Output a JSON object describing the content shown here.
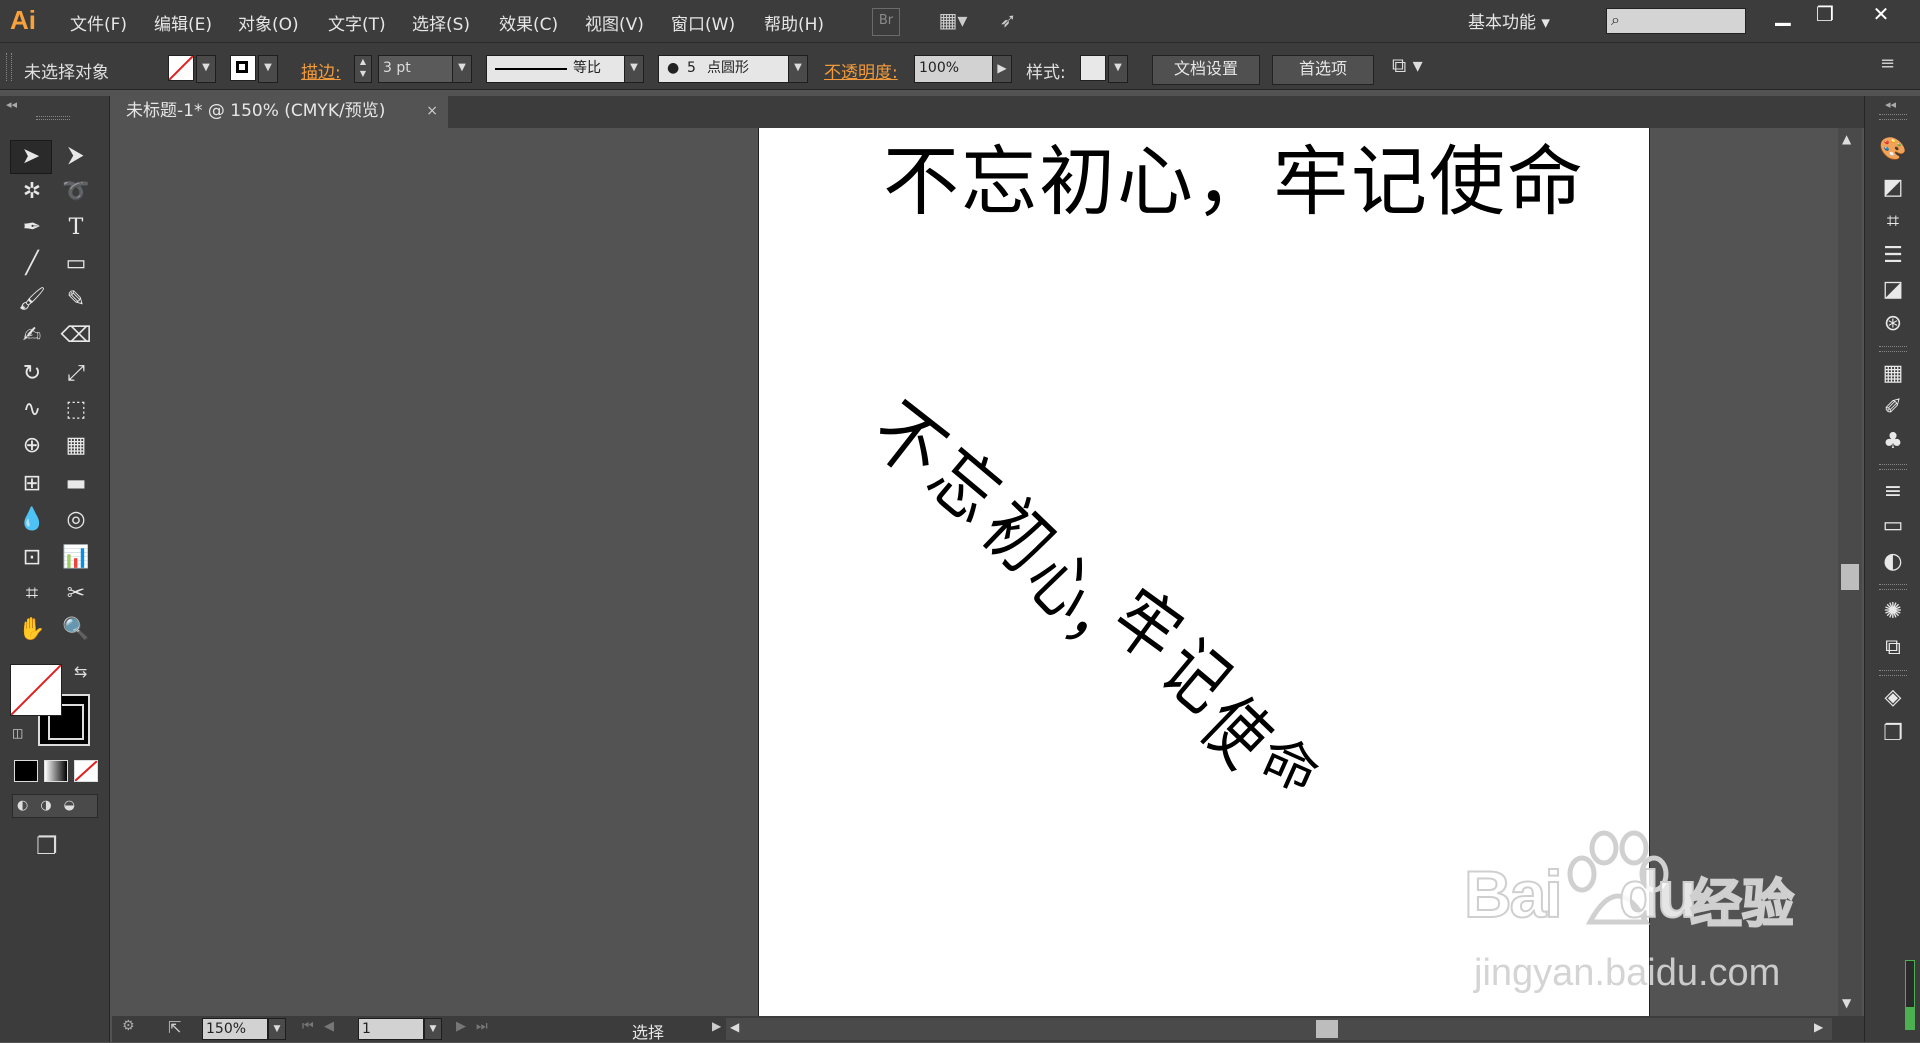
{
  "app": {
    "logo": "Ai"
  },
  "menu": [
    "文件(F)",
    "编辑(E)",
    "对象(O)",
    "文字(T)",
    "选择(S)",
    "效果(C)",
    "视图(V)",
    "窗口(W)",
    "帮助(H)"
  ],
  "toolbar_top": {
    "bridge": "Br",
    "workspace": "基本功能"
  },
  "window_buttons": [
    "minimize-icon",
    "restore-icon",
    "close-icon"
  ],
  "control": {
    "selection_status": "未选择对象",
    "stroke_label": "描边:",
    "stroke_weight": "3 pt",
    "profile": "等比",
    "brush_size": "5",
    "brush_name": "点圆形",
    "opacity_label": "不透明度:",
    "opacity_value": "100%",
    "style_label": "样式:",
    "doc_setup": "文档设置",
    "preferences": "首选项"
  },
  "document_tab": {
    "title": "未标题-1* @ 150% (CMYK/预览)",
    "close": "×"
  },
  "artwork": {
    "heading": "不忘初心，牢记使命",
    "warped_text": [
      "不",
      "忘",
      "初",
      "心",
      "，",
      "牢",
      "记",
      "使",
      "命"
    ]
  },
  "status": {
    "zoom": "150%",
    "artboard_number": "1",
    "current_tool": "选择"
  },
  "watermark": {
    "brand": "Bai",
    "brand_suffix": "du",
    "product": "经验",
    "url": "jingyan.baidu.com"
  },
  "colors": {
    "accent": "#f7a23c",
    "ui_bg": "#3c3c3c",
    "canvas_bg": "#535353"
  }
}
